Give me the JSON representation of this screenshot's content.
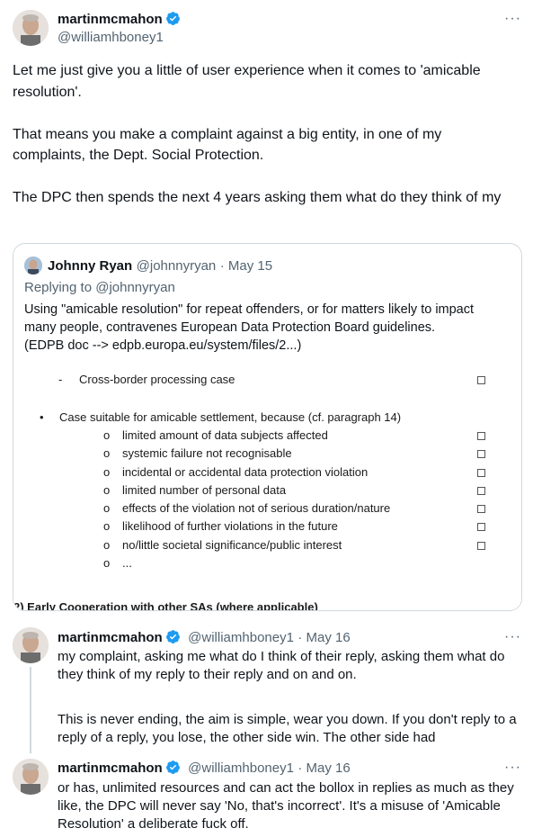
{
  "main_tweet": {
    "display_name": "martinmcmahon",
    "handle": "@williamhboney1",
    "more_label": "···",
    "paragraphs": [
      "Let me just give you a little of user experience when it comes to 'amicable resolution'.",
      "That means you make a complaint against a big entity, in one of my complaints, the Dept. Social Protection.",
      "The DPC then spends the next 4 years asking them what do they think of my"
    ]
  },
  "quoted_tweet": {
    "display_name": "Johnny Ryan",
    "handle": "@johnnyryan",
    "date": "· May 15",
    "replying_to_prefix": "Replying to ",
    "replying_to_handle": "@johnnyryan",
    "text_lines": [
      "Using \"amicable resolution\" for repeat offenders, or for matters likely to impact",
      "many people, contravenes European Data Protection Board guidelines.",
      "(EDPB doc --> edpb.europa.eu/system/files/2...)"
    ],
    "document": {
      "dash": "-",
      "cross_border": "Cross-border processing case",
      "bullet": "•",
      "main_item": "Case suitable for amicable settlement, because (cf. paragraph 14)",
      "sub_bullet": "o",
      "sub_items": [
        "limited amount of data subjects affected",
        "systemic failure not recognisable",
        "incidental or accidental data protection violation",
        "limited number of personal data",
        "effects of the violation not of serious duration/nature",
        "likelihood of further violations in the future",
        "no/little societal significance/public interest",
        "..."
      ],
      "footer_cut": "2) Early Cooperation with other SAs (where applicable)"
    }
  },
  "replies": [
    {
      "display_name": "martinmcmahon",
      "handle": "@williamhboney1",
      "date": "· May 16",
      "more_label": "···",
      "lines": [
        "my complaint, asking me what do I think of their reply, asking them what do",
        "they think of my reply to their reply and on and on.",
        "",
        "This is never ending, the aim is simple, wear you down. If you don't reply to a",
        "reply of a reply, you lose, the other side win. The other side had"
      ]
    },
    {
      "display_name": "martinmcmahon",
      "handle": "@williamhboney1",
      "date": "· May 16",
      "more_label": "···",
      "lines": [
        "or has, unlimited resources and can act the bollox in replies as much as they",
        "like, the DPC will never say 'No, that's incorrect'. It's a misuse of 'Amicable",
        "Resolution' a deliberate fuck off."
      ]
    }
  ],
  "colors": {
    "verified": "#1d9bf0",
    "secondary_text": "#536471",
    "border": "#cfd9de"
  }
}
